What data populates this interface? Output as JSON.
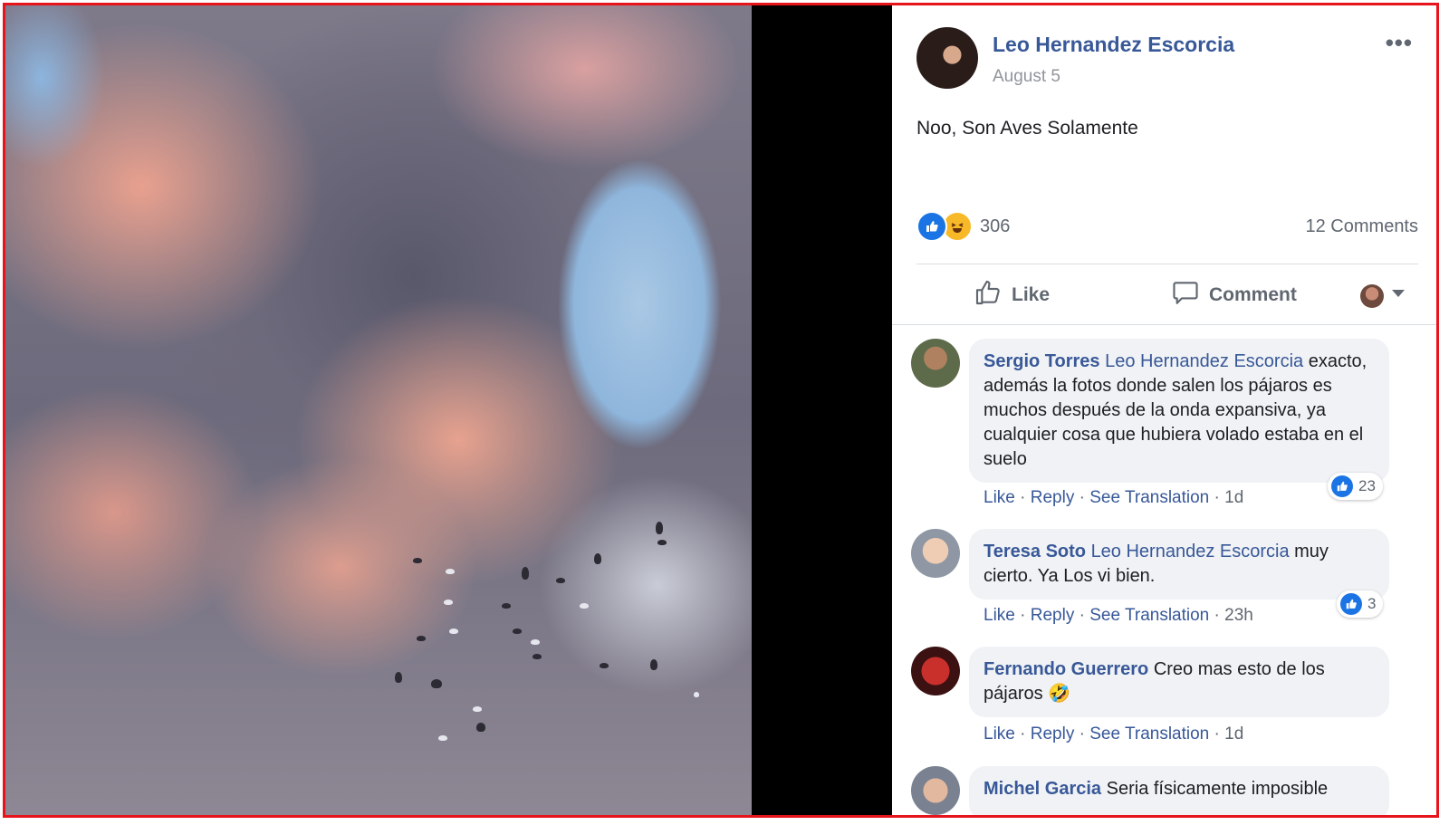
{
  "post": {
    "author": "Leo Hernandez Escorcia",
    "date": "August 5",
    "text": "Noo, Son Aves Solamente",
    "reaction_count": "306",
    "comments_count": "12 Comments",
    "more_icon": "•••"
  },
  "actions": {
    "like_label": "Like",
    "comment_label": "Comment"
  },
  "comments": [
    {
      "name": "Sergio Torres",
      "mention": "Leo Hernandez Escorcia",
      "text": "exacto, además la fotos donde salen los pájaros es muchos después de la onda expansiva, ya cualquier cosa que hubiera volado estaba en el suelo",
      "like": "Like",
      "reply": "Reply",
      "translate": "See Translation",
      "time": "1d",
      "reactions": "23"
    },
    {
      "name": "Teresa Soto",
      "mention": "Leo Hernandez Escorcia",
      "text": "muy cierto. Ya Los vi bien.",
      "like": "Like",
      "reply": "Reply",
      "translate": "See Translation",
      "time": "23h",
      "reactions": "3"
    },
    {
      "name": "Fernando Guerrero",
      "mention": "",
      "text": "Creo mas esto de los pájaros 🤣",
      "like": "Like",
      "reply": "Reply",
      "translate": "See Translation",
      "time": "1d",
      "reactions": ""
    },
    {
      "name": "Michel Garcia",
      "mention": "",
      "text": "Seria físicamente imposible",
      "like": "",
      "reply": "",
      "translate": "",
      "time": "",
      "reactions": ""
    }
  ],
  "colors": {
    "link": "#385898",
    "border": "#e8141c",
    "like_blue": "#1b74e4"
  }
}
